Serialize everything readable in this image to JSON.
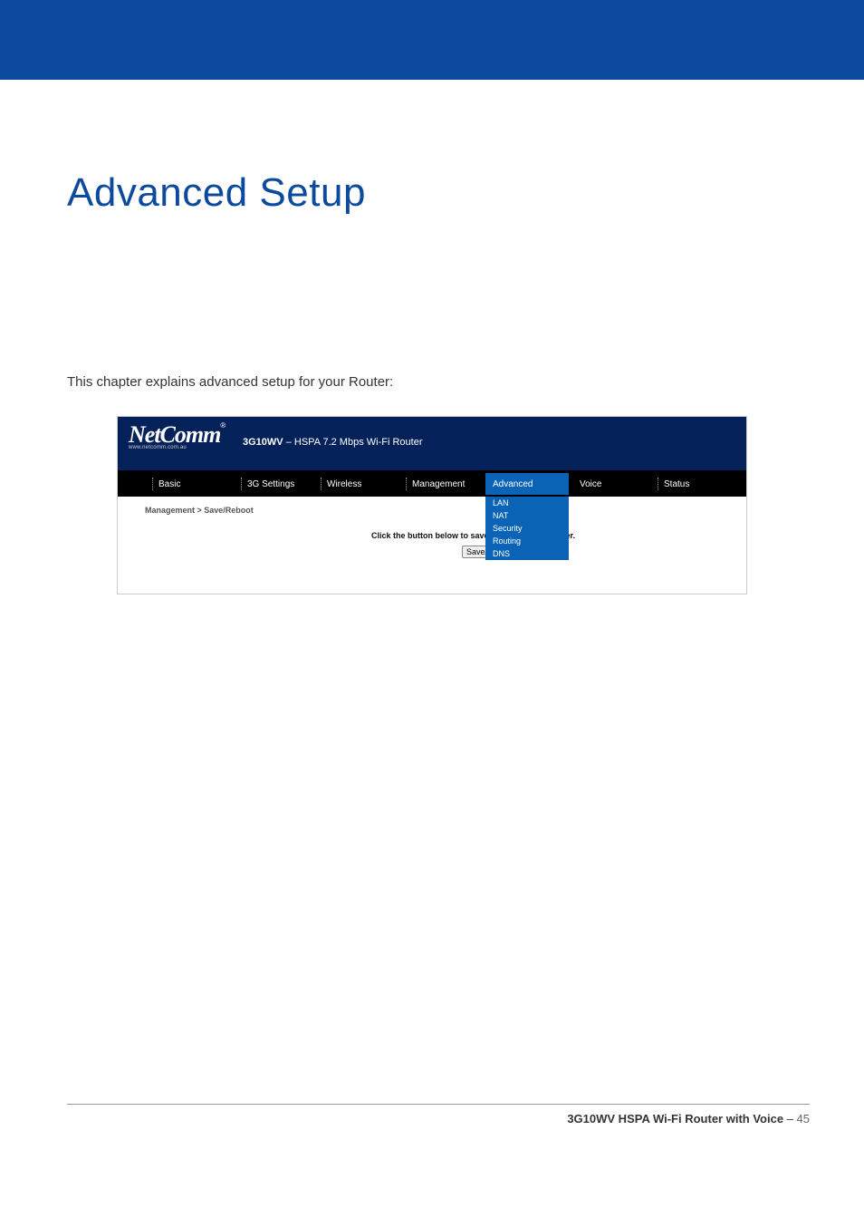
{
  "header_bar": {},
  "page": {
    "title": "Advanced Setup",
    "intro": "This chapter explains advanced setup for your Router:"
  },
  "router_ui": {
    "brand": "NetComm",
    "brand_url": "www.netcomm.com.au",
    "model": "3G10WV",
    "tagline": " – HSPA 7.2 Mbps Wi-Fi Router",
    "nav": {
      "basic": "Basic",
      "three_g": "3G Settings",
      "wireless": "Wireless",
      "management": "Management",
      "advanced": "Advanced",
      "voice": "Voice",
      "status": "Status"
    },
    "dropdown": {
      "lan": "LAN",
      "nat": "NAT",
      "security": "Security",
      "routing": "Routing",
      "dns": "DNS"
    },
    "content": {
      "breadcrumb": "Management > Save/Reboot",
      "instruction": "Click the button below to save and reboot the router.",
      "button_label": "Save/Reboot"
    }
  },
  "footer": {
    "product": "3G10WV HSPA Wi-Fi Router with Voice",
    "sep": " – ",
    "page_number": "45"
  }
}
